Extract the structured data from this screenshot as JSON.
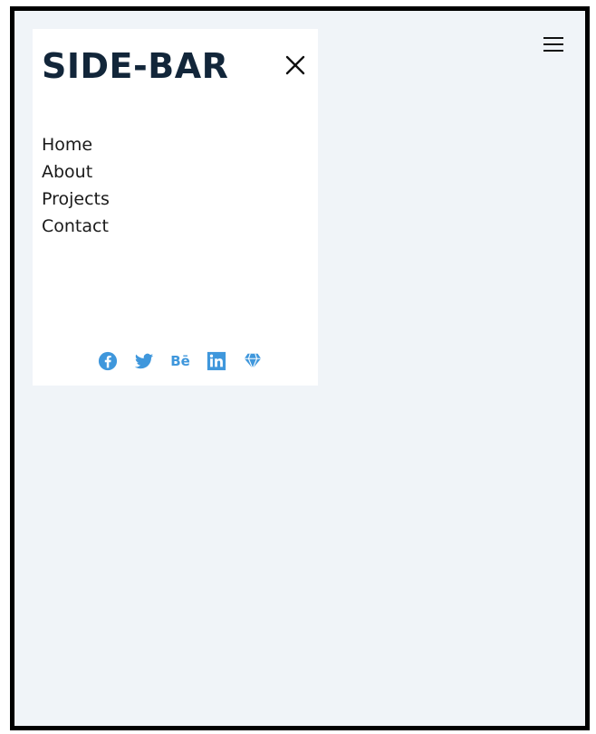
{
  "sidebar": {
    "title": "SIDE-BAR",
    "nav_items": [
      {
        "label": "Home"
      },
      {
        "label": "About"
      },
      {
        "label": "Projects"
      },
      {
        "label": "Contact"
      }
    ],
    "social_icons": [
      "facebook-icon",
      "twitter-icon",
      "behance-icon",
      "linkedin-icon",
      "gem-icon"
    ],
    "behance_text": "Bē"
  },
  "colors": {
    "background": "#f0f4f8",
    "sidebar_background": "#ffffff",
    "title": "#12263a",
    "icon_accent": "#3f97dc",
    "border": "#000000"
  },
  "icons": {
    "menu": "hamburger-menu-icon",
    "close": "close-icon"
  }
}
